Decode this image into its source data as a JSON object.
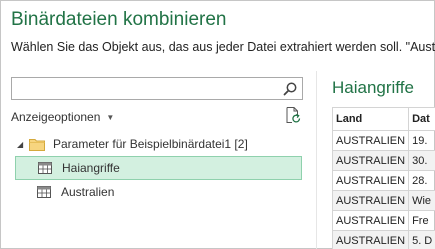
{
  "dialog": {
    "title": "Binärdateien kombinieren",
    "instruction": "Wählen Sie das Objekt aus, das aus jeder Datei extrahiert werden soll. \"Austr"
  },
  "search": {
    "value": "",
    "placeholder": ""
  },
  "display_options": {
    "label": "Anzeigeoptionen"
  },
  "tree": {
    "folder_label": "Parameter für Beispielbinärdatei1 [2]",
    "items": [
      {
        "label": "Haiangriffe",
        "selected": true
      },
      {
        "label": "Australien",
        "selected": false
      }
    ]
  },
  "preview": {
    "title": "Haiangriffe",
    "columns": [
      "Land",
      "Dat"
    ],
    "rows": [
      [
        "AUSTRALIEN",
        "19."
      ],
      [
        "AUSTRALIEN",
        "30."
      ],
      [
        "AUSTRALIEN",
        "28."
      ],
      [
        "AUSTRALIEN",
        "Wie"
      ],
      [
        "AUSTRALIEN",
        "Fre"
      ],
      [
        "AUSTRALIEN",
        "5. D"
      ]
    ]
  },
  "colors": {
    "accent": "#217346",
    "selection_fill": "#d3f0e0",
    "selection_border": "#8fd1ad"
  }
}
